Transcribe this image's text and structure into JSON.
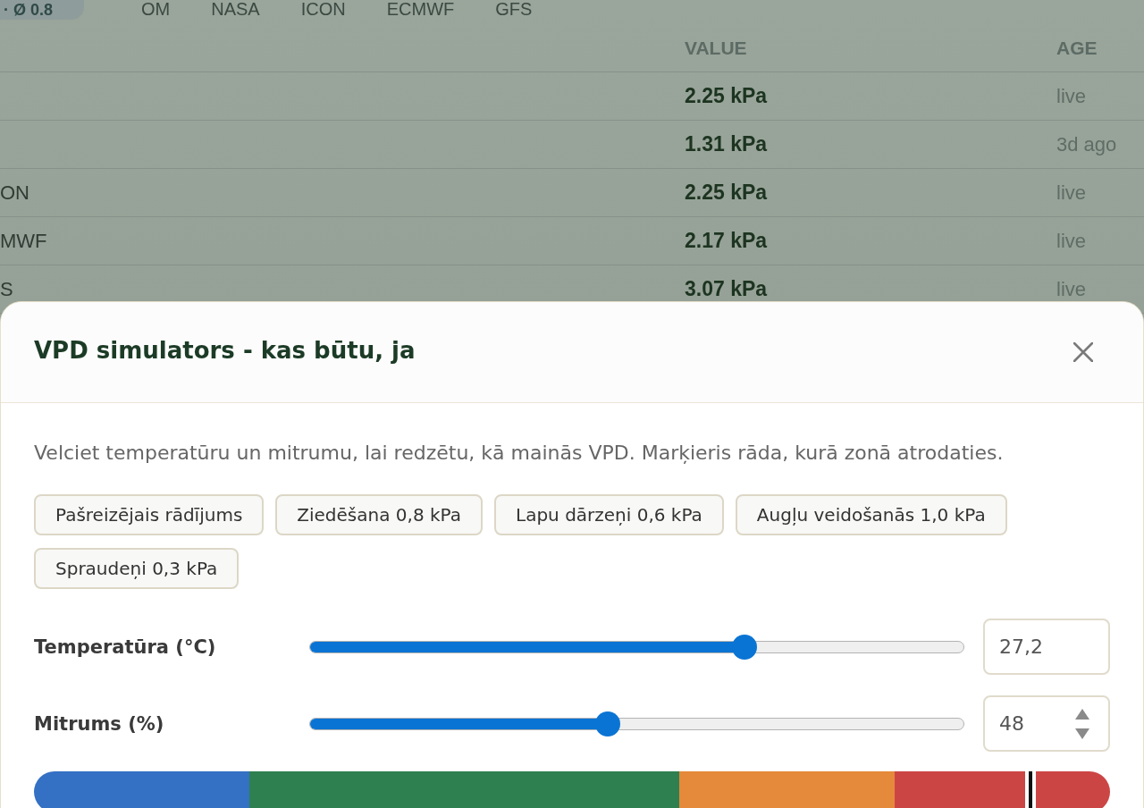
{
  "background_page": {
    "summary_pill": "· Ø 0.8",
    "source_tabs": [
      "OM",
      "NASA",
      "ICON",
      "ECMWF",
      "GFS"
    ],
    "table": {
      "columns": [
        "VALUE",
        "AGE"
      ],
      "rows": [
        {
          "value": "2.25 kPa",
          "age": "live"
        },
        {
          "value": "1.31 kPa",
          "age": "3d ago"
        },
        {
          "name": "ON",
          "value": "2.25 kPa",
          "age": "live"
        },
        {
          "name": "MWF",
          "value": "2.17 kPa",
          "age": "live"
        },
        {
          "name": "S",
          "value": "3.07 kPa",
          "age": "live"
        }
      ]
    }
  },
  "dialog": {
    "title": "VPD simulators - kas būtu, ja",
    "description": "Velciet temperatūru un mitrumu, lai redzētu, kā mainās VPD. Marķieris rāda, kurā zonā atrodaties.",
    "presets": [
      "Pašreizējais rādījums",
      "Ziedēšana 0,8 kPa",
      "Lapu dārzeņi 0,6 kPa",
      "Augļu veidošanās 1,0 kPa",
      "Spraudeņi 0,3 kPa"
    ],
    "sliders": [
      {
        "label": "Temperatūra (°C)",
        "level": 0.664,
        "value": "27,2",
        "stepper": false
      },
      {
        "label": "Mitrums (%)",
        "level": 0.456,
        "value": "48",
        "stepper": true
      }
    ],
    "zone_bar": {
      "zones": [
        {
          "kind": "normal",
          "color": "#3470c4"
        },
        {
          "kind": "wide",
          "color": "#2e8050"
        },
        {
          "kind": "normal",
          "color": "#e5893a"
        },
        {
          "kind": "normal",
          "color": "#cc4545"
        }
      ],
      "marker": {
        "level": 0.926
      }
    }
  }
}
